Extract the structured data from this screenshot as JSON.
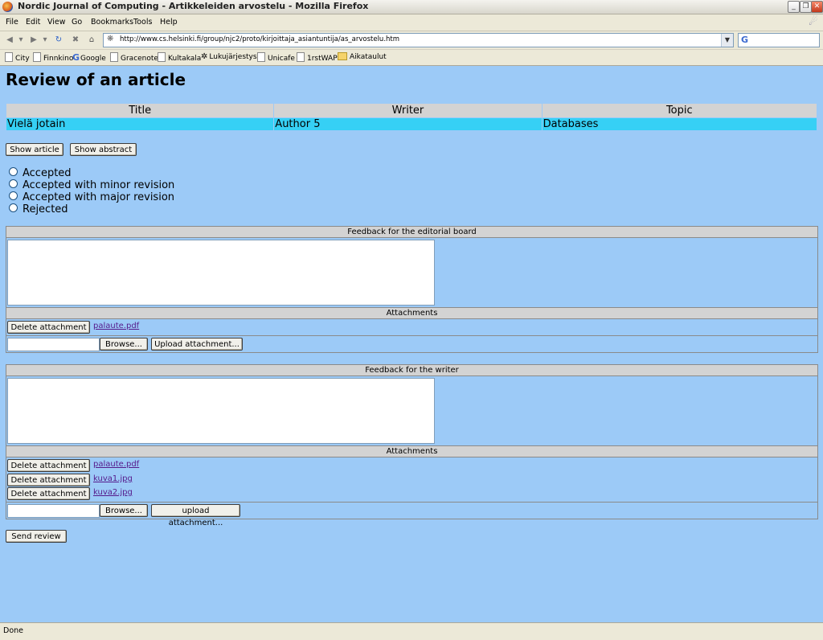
{
  "window": {
    "title": "Nordic Journal of Computing - Artikkeleiden arvostelu - Mozilla Firefox"
  },
  "menu": [
    "File",
    "Edit",
    "View",
    "Go",
    "Bookmarks",
    "Tools",
    "Help"
  ],
  "address": {
    "url": "http://www.cs.helsinki.fi/group/njc2/proto/kirjoittaja_asiantuntija/as_arvostelu.htm"
  },
  "bookmarks": [
    "City",
    "Finnkino",
    "Google",
    "Gracenote",
    "Kultakala",
    "Lukujärjestys",
    "Unicafe",
    "1rstWAP",
    "Aikataulut"
  ],
  "page": {
    "heading": "Review of an article",
    "table": {
      "headers": [
        "Title",
        "Writer",
        "Topic"
      ],
      "row": [
        "Vielä jotain",
        "Author 5",
        "Databases"
      ]
    },
    "show_article": "Show article",
    "show_abstract": "Show abstract",
    "decision_options": [
      "Accepted",
      "Accepted with minor revision",
      "Accepted with major revision",
      "Rejected"
    ],
    "editorial": {
      "header": "Feedback for the editorial board",
      "attachments_header": "Attachments",
      "attachments": [
        {
          "delete_label": "Delete attachment",
          "file": "palaute.pdf"
        }
      ],
      "browse_label": "Browse...",
      "upload_label": "Upload attachment..."
    },
    "writer": {
      "header": "Feedback for the writer",
      "attachments_header": "Attachments",
      "attachments": [
        {
          "delete_label": "Delete attachment",
          "file": "palaute.pdf"
        },
        {
          "delete_label": "Delete attachment",
          "file": "kuva1.jpg"
        },
        {
          "delete_label": "Delete attachment",
          "file": "kuva2.jpg"
        }
      ],
      "browse_label": "Browse...",
      "upload_label": "upload attachment..."
    },
    "send_review": "Send review"
  },
  "status": {
    "text": "Done"
  }
}
